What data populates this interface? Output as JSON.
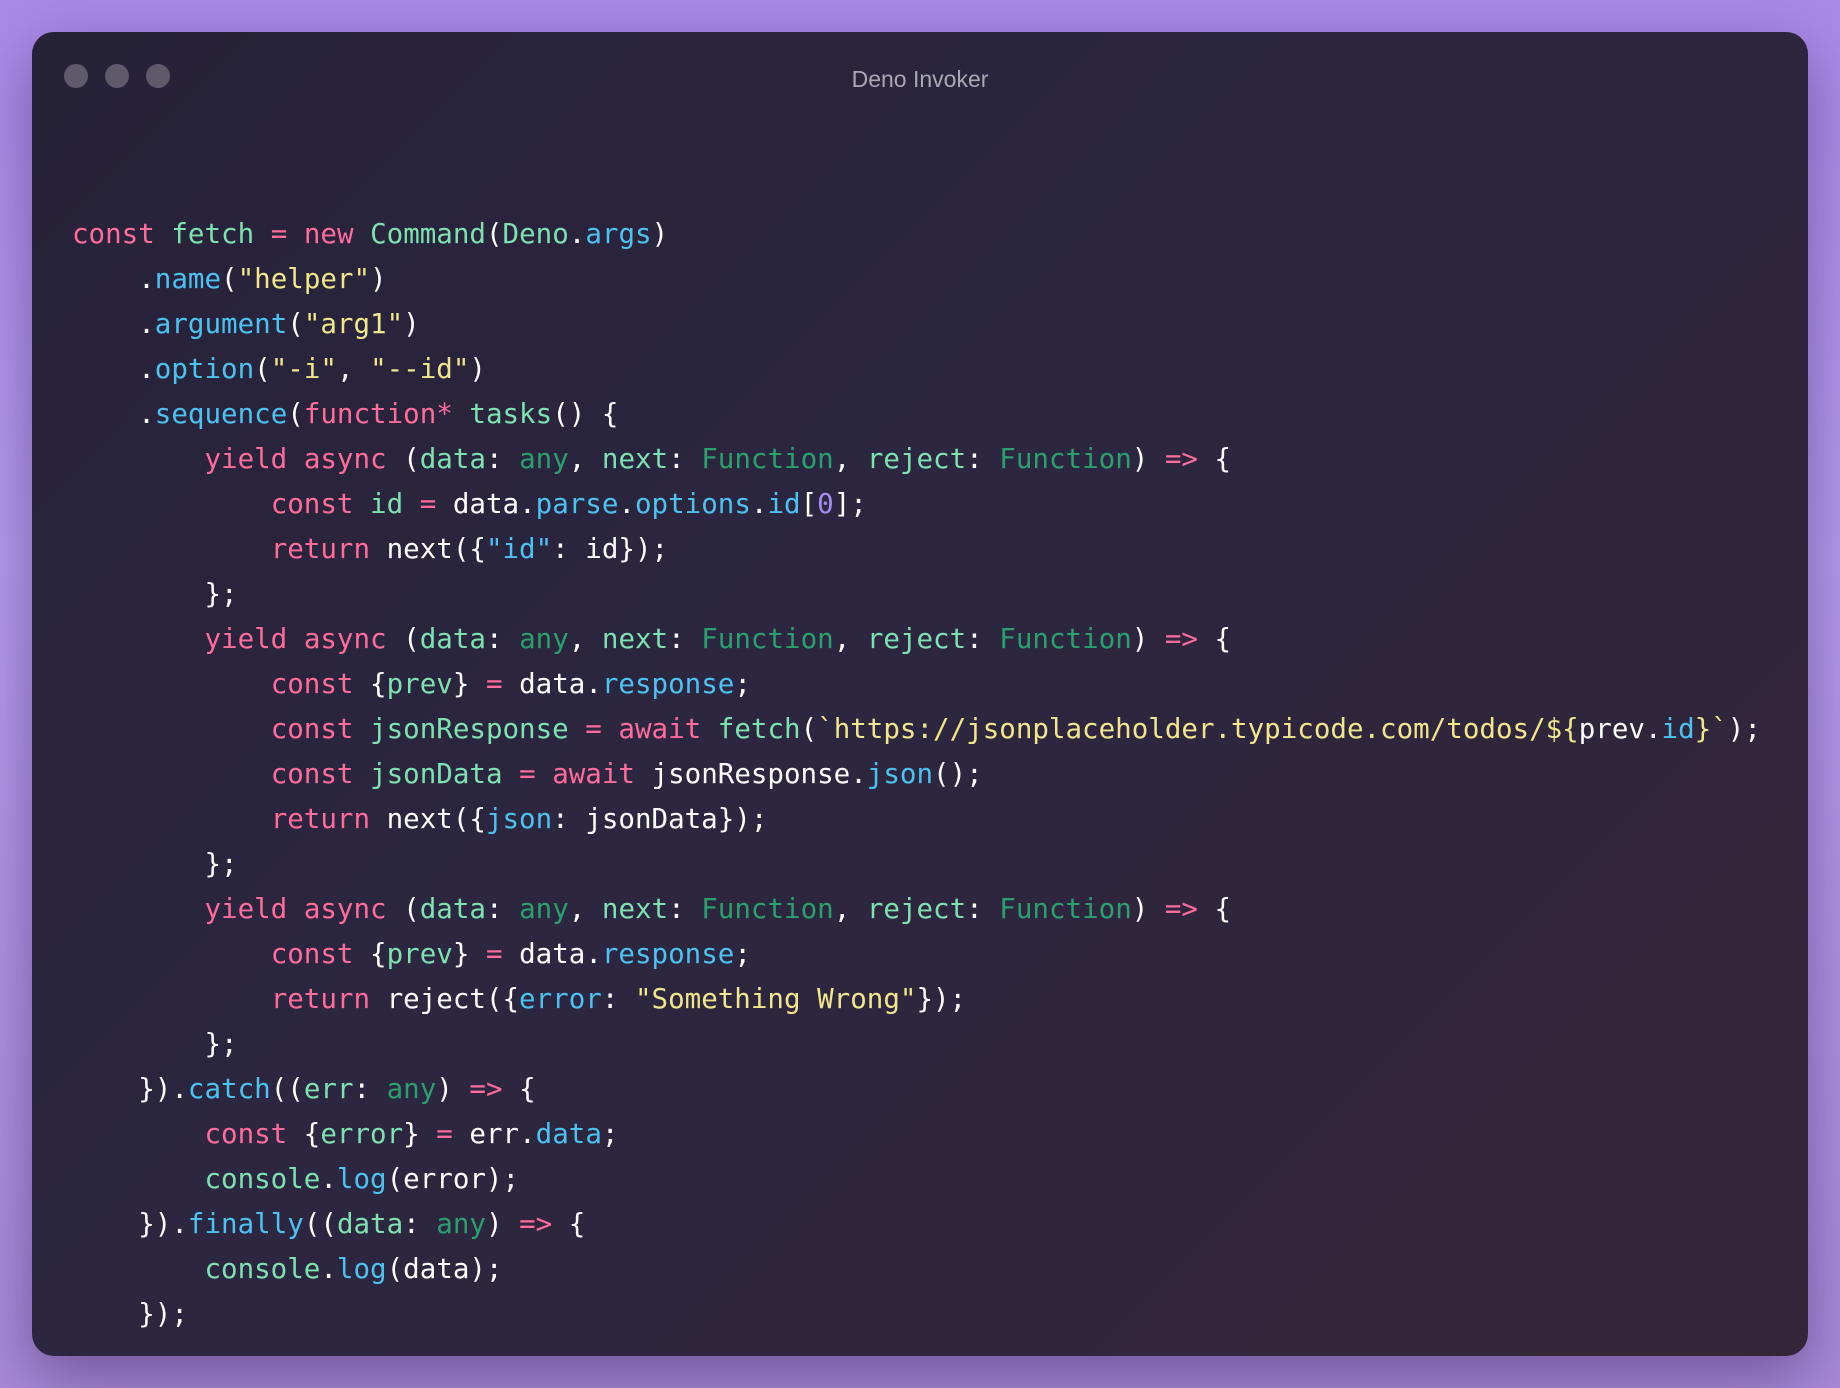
{
  "window": {
    "title": "Deno Invoker"
  },
  "colors": {
    "keyword": "#ff6b9a",
    "function": "#7de2b0",
    "property": "#4cc2f0",
    "string": "#f0e68c",
    "type": "#29a06e",
    "number": "#a48cf2",
    "default": "#ffffff"
  },
  "code_lines": [
    [
      [
        "kw",
        "const"
      ],
      [
        "df",
        " "
      ],
      [
        "fn",
        "fetch"
      ],
      [
        "df",
        " "
      ],
      [
        "kw",
        "="
      ],
      [
        "df",
        " "
      ],
      [
        "kw",
        "new"
      ],
      [
        "df",
        " "
      ],
      [
        "fn",
        "Command"
      ],
      [
        "df",
        "("
      ],
      [
        "fn",
        "Deno"
      ],
      [
        "df",
        "."
      ],
      [
        "pr",
        "args"
      ],
      [
        "df",
        ")"
      ]
    ],
    [
      [
        "df",
        "    ."
      ],
      [
        "pr",
        "name"
      ],
      [
        "df",
        "("
      ],
      [
        "st",
        "\"helper\""
      ],
      [
        "df",
        ")"
      ]
    ],
    [
      [
        "df",
        "    ."
      ],
      [
        "pr",
        "argument"
      ],
      [
        "df",
        "("
      ],
      [
        "st",
        "\"arg1\""
      ],
      [
        "df",
        ")"
      ]
    ],
    [
      [
        "df",
        "    ."
      ],
      [
        "pr",
        "option"
      ],
      [
        "df",
        "("
      ],
      [
        "st",
        "\"-i\""
      ],
      [
        "df",
        ", "
      ],
      [
        "st",
        "\"--id\""
      ],
      [
        "df",
        ")"
      ]
    ],
    [
      [
        "df",
        "    ."
      ],
      [
        "pr",
        "sequence"
      ],
      [
        "df",
        "("
      ],
      [
        "kw",
        "function*"
      ],
      [
        "df",
        " "
      ],
      [
        "fn",
        "tasks"
      ],
      [
        "df",
        "() {"
      ]
    ],
    [
      [
        "df",
        "        "
      ],
      [
        "kw",
        "yield"
      ],
      [
        "df",
        " "
      ],
      [
        "kw",
        "async"
      ],
      [
        "df",
        " ("
      ],
      [
        "fn",
        "data"
      ],
      [
        "df",
        ": "
      ],
      [
        "ty",
        "any"
      ],
      [
        "df",
        ", "
      ],
      [
        "fn",
        "next"
      ],
      [
        "df",
        ": "
      ],
      [
        "ty",
        "Function"
      ],
      [
        "df",
        ", "
      ],
      [
        "fn",
        "reject"
      ],
      [
        "df",
        ": "
      ],
      [
        "ty",
        "Function"
      ],
      [
        "df",
        ") "
      ],
      [
        "kw",
        "=>"
      ],
      [
        "df",
        " {"
      ]
    ],
    [
      [
        "df",
        "            "
      ],
      [
        "kw",
        "const"
      ],
      [
        "df",
        " "
      ],
      [
        "fn",
        "id"
      ],
      [
        "df",
        " "
      ],
      [
        "kw",
        "="
      ],
      [
        "df",
        " data."
      ],
      [
        "pr",
        "parse"
      ],
      [
        "df",
        "."
      ],
      [
        "pr",
        "options"
      ],
      [
        "df",
        "."
      ],
      [
        "pr",
        "id"
      ],
      [
        "df",
        "["
      ],
      [
        "nm",
        "0"
      ],
      [
        "df",
        "];"
      ]
    ],
    [
      [
        "df",
        "            "
      ],
      [
        "kw",
        "return"
      ],
      [
        "df",
        " next({"
      ],
      [
        "pr",
        "\"id\""
      ],
      [
        "df",
        ": id});"
      ]
    ],
    [
      [
        "df",
        "        };"
      ]
    ],
    [
      [
        "df",
        "        "
      ],
      [
        "kw",
        "yield"
      ],
      [
        "df",
        " "
      ],
      [
        "kw",
        "async"
      ],
      [
        "df",
        " ("
      ],
      [
        "fn",
        "data"
      ],
      [
        "df",
        ": "
      ],
      [
        "ty",
        "any"
      ],
      [
        "df",
        ", "
      ],
      [
        "fn",
        "next"
      ],
      [
        "df",
        ": "
      ],
      [
        "ty",
        "Function"
      ],
      [
        "df",
        ", "
      ],
      [
        "fn",
        "reject"
      ],
      [
        "df",
        ": "
      ],
      [
        "ty",
        "Function"
      ],
      [
        "df",
        ") "
      ],
      [
        "kw",
        "=>"
      ],
      [
        "df",
        " {"
      ]
    ],
    [
      [
        "df",
        "            "
      ],
      [
        "kw",
        "const"
      ],
      [
        "df",
        " {"
      ],
      [
        "fn",
        "prev"
      ],
      [
        "df",
        "} "
      ],
      [
        "kw",
        "="
      ],
      [
        "df",
        " data."
      ],
      [
        "pr",
        "response"
      ],
      [
        "df",
        ";"
      ]
    ],
    [
      [
        "df",
        "            "
      ],
      [
        "kw",
        "const"
      ],
      [
        "df",
        " "
      ],
      [
        "fn",
        "jsonResponse"
      ],
      [
        "df",
        " "
      ],
      [
        "kw",
        "="
      ],
      [
        "df",
        " "
      ],
      [
        "kw",
        "await"
      ],
      [
        "df",
        " "
      ],
      [
        "fn",
        "fetch"
      ],
      [
        "df",
        "("
      ],
      [
        "st",
        "`https://jsonplaceholder.typicode.com/todos/${"
      ],
      [
        "df",
        "prev."
      ],
      [
        "pr",
        "id"
      ],
      [
        "st",
        "}`"
      ],
      [
        "df",
        ");"
      ]
    ],
    [
      [
        "df",
        "            "
      ],
      [
        "kw",
        "const"
      ],
      [
        "df",
        " "
      ],
      [
        "fn",
        "jsonData"
      ],
      [
        "df",
        " "
      ],
      [
        "kw",
        "="
      ],
      [
        "df",
        " "
      ],
      [
        "kw",
        "await"
      ],
      [
        "df",
        " jsonResponse."
      ],
      [
        "pr",
        "json"
      ],
      [
        "df",
        "();"
      ]
    ],
    [
      [
        "df",
        "            "
      ],
      [
        "kw",
        "return"
      ],
      [
        "df",
        " next({"
      ],
      [
        "pr",
        "json"
      ],
      [
        "df",
        ": jsonData});"
      ]
    ],
    [
      [
        "df",
        "        };"
      ]
    ],
    [
      [
        "df",
        "        "
      ],
      [
        "kw",
        "yield"
      ],
      [
        "df",
        " "
      ],
      [
        "kw",
        "async"
      ],
      [
        "df",
        " ("
      ],
      [
        "fn",
        "data"
      ],
      [
        "df",
        ": "
      ],
      [
        "ty",
        "any"
      ],
      [
        "df",
        ", "
      ],
      [
        "fn",
        "next"
      ],
      [
        "df",
        ": "
      ],
      [
        "ty",
        "Function"
      ],
      [
        "df",
        ", "
      ],
      [
        "fn",
        "reject"
      ],
      [
        "df",
        ": "
      ],
      [
        "ty",
        "Function"
      ],
      [
        "df",
        ") "
      ],
      [
        "kw",
        "=>"
      ],
      [
        "df",
        " {"
      ]
    ],
    [
      [
        "df",
        "            "
      ],
      [
        "kw",
        "const"
      ],
      [
        "df",
        " {"
      ],
      [
        "fn",
        "prev"
      ],
      [
        "df",
        "} "
      ],
      [
        "kw",
        "="
      ],
      [
        "df",
        " data."
      ],
      [
        "pr",
        "response"
      ],
      [
        "df",
        ";"
      ]
    ],
    [
      [
        "df",
        "            "
      ],
      [
        "kw",
        "return"
      ],
      [
        "df",
        " reject({"
      ],
      [
        "pr",
        "error"
      ],
      [
        "df",
        ": "
      ],
      [
        "st",
        "\"Something Wrong\""
      ],
      [
        "df",
        "});"
      ]
    ],
    [
      [
        "df",
        "        };"
      ]
    ],
    [
      [
        "df",
        "    })."
      ],
      [
        "pr",
        "catch"
      ],
      [
        "df",
        "(("
      ],
      [
        "fn",
        "err"
      ],
      [
        "df",
        ": "
      ],
      [
        "ty",
        "any"
      ],
      [
        "df",
        ") "
      ],
      [
        "kw",
        "=>"
      ],
      [
        "df",
        " {"
      ]
    ],
    [
      [
        "df",
        "        "
      ],
      [
        "kw",
        "const"
      ],
      [
        "df",
        " {"
      ],
      [
        "fn",
        "error"
      ],
      [
        "df",
        "} "
      ],
      [
        "kw",
        "="
      ],
      [
        "df",
        " err."
      ],
      [
        "pr",
        "data"
      ],
      [
        "df",
        ";"
      ]
    ],
    [
      [
        "df",
        "        "
      ],
      [
        "fn",
        "console"
      ],
      [
        "df",
        "."
      ],
      [
        "pr",
        "log"
      ],
      [
        "df",
        "(error);"
      ]
    ],
    [
      [
        "df",
        "    })."
      ],
      [
        "pr",
        "finally"
      ],
      [
        "df",
        "(("
      ],
      [
        "fn",
        "data"
      ],
      [
        "df",
        ": "
      ],
      [
        "ty",
        "any"
      ],
      [
        "df",
        ") "
      ],
      [
        "kw",
        "=>"
      ],
      [
        "df",
        " {"
      ]
    ],
    [
      [
        "df",
        "        "
      ],
      [
        "fn",
        "console"
      ],
      [
        "df",
        "."
      ],
      [
        "pr",
        "log"
      ],
      [
        "df",
        "(data);"
      ]
    ],
    [
      [
        "df",
        "    });"
      ]
    ]
  ]
}
